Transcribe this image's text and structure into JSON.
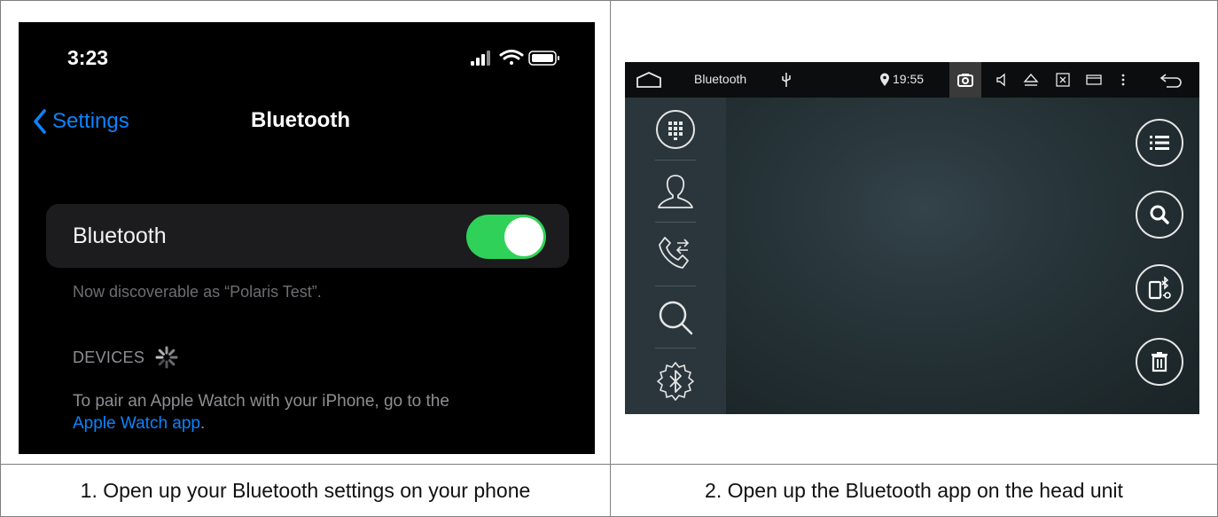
{
  "phone": {
    "status_time": "3:23",
    "back_label": "Settings",
    "title": "Bluetooth",
    "bluetooth_row_label": "Bluetooth",
    "bluetooth_enabled": true,
    "discoverable_text": "Now discoverable as “Polaris Test”.",
    "devices_header": "DEVICES",
    "pair_text": "To pair an Apple Watch with your iPhone, go to the",
    "pair_link": "Apple Watch app",
    "pair_suffix": ".",
    "toggle_color": "#30d158",
    "link_color": "#0a84ff"
  },
  "head_unit": {
    "title": "Bluetooth",
    "time": "19:55",
    "status_icons": [
      "home-icon",
      "usb-icon",
      "location-icon",
      "camera-icon",
      "volume-icon",
      "eject-icon",
      "close-box-icon",
      "window-icon",
      "more-icon",
      "back-icon"
    ],
    "side_buttons": [
      "dialpad-icon",
      "contacts-icon",
      "call-log-icon",
      "search-icon",
      "bluetooth-settings-icon"
    ],
    "right_buttons": [
      "list-icon",
      "search-icon",
      "phone-bluetooth-icon",
      "trash-icon"
    ]
  },
  "captions": {
    "step1": "1. Open up your Bluetooth settings on your phone",
    "step2": "2. Open up the Bluetooth app on the head unit"
  }
}
